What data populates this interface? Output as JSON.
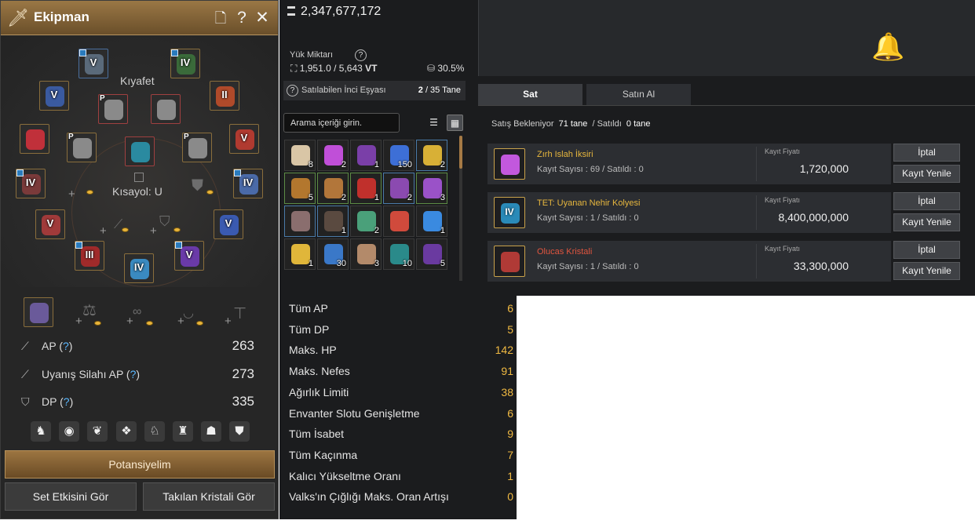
{
  "equipment": {
    "title": "Ekipman",
    "outfit_label": "Kıyafet",
    "shortcut_label": "Kısayol: U",
    "slots": [
      {
        "level": "V",
        "pmark": ""
      },
      {
        "level": "IV",
        "pmark": ""
      },
      {
        "level": "V",
        "pmark": ""
      },
      {
        "level": "",
        "pmark": "P"
      },
      {
        "level": "",
        "pmark": ""
      },
      {
        "level": "II",
        "pmark": ""
      },
      {
        "level": "",
        "pmark": ""
      },
      {
        "level": "",
        "pmark": "P"
      },
      {
        "level": "",
        "pmark": ""
      },
      {
        "level": "",
        "pmark": "P"
      },
      {
        "level": "V",
        "pmark": ""
      },
      {
        "level": "IV",
        "pmark": ""
      },
      {
        "level": "IV",
        "pmark": ""
      },
      {
        "level": "V",
        "pmark": ""
      },
      {
        "level": "V",
        "pmark": ""
      },
      {
        "level": "III",
        "pmark": ""
      },
      {
        "level": "IV",
        "pmark": ""
      },
      {
        "level": "V",
        "pmark": ""
      }
    ],
    "stats": [
      {
        "label": "AP",
        "help": "?",
        "value": "263"
      },
      {
        "label": "Uyanış Silahı AP",
        "help": "?",
        "value": "273"
      },
      {
        "label": "DP",
        "help": "?",
        "value": "335"
      }
    ],
    "buttons": {
      "potential": "Potansiyelim",
      "set_effect": "Set Etkisini Gör",
      "crystals": "Takılan Kristali Gör"
    }
  },
  "inventory": {
    "silver": "2,347,677,172",
    "weight_label": "Yük Miktarı",
    "weight": "1,951.0 / 5,643",
    "weight_unit": "VT",
    "weight_percent": "30.5%",
    "pearl_label": "Satılabilen İnci Eşyası",
    "pearl_count": "2",
    "pearl_total": "/ 35 Tane",
    "search_placeholder": "Arama içeriği girin.",
    "items": [
      {
        "count": "8",
        "color": "#d9c6a6",
        "border": ""
      },
      {
        "count": "2",
        "color": "#c04fd8",
        "border": ""
      },
      {
        "count": "1",
        "color": "#7a3fa8",
        "border": ""
      },
      {
        "count": "150",
        "color": "#3d6fd6",
        "border": ""
      },
      {
        "count": "2",
        "color": "#d8b036",
        "border": "blue"
      },
      {
        "count": "5",
        "color": "#b3772e",
        "border": "green"
      },
      {
        "count": "2",
        "color": "#b2763a",
        "border": "green"
      },
      {
        "count": "1",
        "color": "#c0302c",
        "border": "green"
      },
      {
        "count": "2",
        "color": "#8b4ab0",
        "border": "blue"
      },
      {
        "count": "3",
        "color": "#9a52c8",
        "border": "green"
      },
      {
        "count": "",
        "color": "#8a6e6e",
        "border": "blue"
      },
      {
        "count": "1",
        "color": "#5a4a40",
        "border": "blue"
      },
      {
        "count": "2",
        "color": "#4aa07a",
        "border": ""
      },
      {
        "count": "",
        "color": "#d04a3c",
        "border": ""
      },
      {
        "count": "1",
        "color": "#3a8ae0",
        "border": ""
      },
      {
        "count": "1",
        "color": "#e0b63a",
        "border": ""
      },
      {
        "count": "30",
        "color": "#3a78c8",
        "border": ""
      },
      {
        "count": "3",
        "color": "#b38a6a",
        "border": ""
      },
      {
        "count": "10",
        "color": "#2a8a8a",
        "border": ""
      },
      {
        "count": "5",
        "color": "#6a3aa0",
        "border": ""
      }
    ]
  },
  "market": {
    "tabs": {
      "sell": "Sat",
      "buy": "Satın Al"
    },
    "summary": {
      "pending_label": "Satış Bekleniyor",
      "pending_count": "71",
      "unit": "tane",
      "sold_label": "/ Satıldı",
      "sold_count": "0",
      "sold_unit": "tane"
    },
    "listings": [
      {
        "name": "Zırh Islah İksiri",
        "name_color": "#e7b73e",
        "sub": "Kayıt Sayısı : 69 / Satıldı : 0",
        "price_label": "Kayıt Fiyatı",
        "price": "1,720,000",
        "icon_color": "#c258dd",
        "icon_level": ""
      },
      {
        "name": "TET: Uyanan Nehir Kolyesi",
        "name_color": "#e7b73e",
        "sub": "Kayıt Sayısı : 1 / Satıldı : 0",
        "price_label": "Kayıt Fiyatı",
        "price": "8,400,000,000",
        "icon_color": "#2a8ab8",
        "icon_level": "IV"
      },
      {
        "name": "Olucas Kristali",
        "name_color": "#e0553f",
        "sub": "Kayıt Sayısı : 1 / Satıldı : 0",
        "price_label": "Kayıt Fiyatı",
        "price": "33,300,000",
        "icon_color": "#b03a36",
        "icon_level": ""
      }
    ],
    "cancel_label": "İptal",
    "renew_label": "Kayıt Yenile"
  },
  "bonus_stats": [
    {
      "label": "Tüm AP",
      "value": "6"
    },
    {
      "label": "Tüm DP",
      "value": "5"
    },
    {
      "label": "Maks. HP",
      "value": "142"
    },
    {
      "label": "Maks. Nefes",
      "value": "91"
    },
    {
      "label": "Ağırlık Limiti",
      "value": "38"
    },
    {
      "label": "Envanter Slotu Genişletme",
      "value": "6"
    },
    {
      "label": "Tüm İsabet",
      "value": "9"
    },
    {
      "label": "Tüm Kaçınma",
      "value": "7"
    },
    {
      "label": "Kalıcı Yükseltme Oranı",
      "value": "1"
    },
    {
      "label": "Valks'ın Çığlığı Maks. Oran Artışı",
      "value": "0"
    }
  ]
}
